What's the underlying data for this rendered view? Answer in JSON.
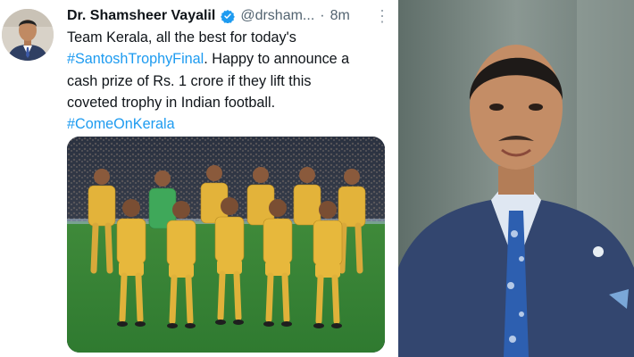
{
  "tweet": {
    "author_name": "Dr. Shamsheer Vayalil",
    "handle": "@drsham...",
    "separator": "·",
    "time": "8m",
    "more_icon": "more-vertical-icon",
    "verified_icon": "verified-badge-icon",
    "text_lines": [
      {
        "text": "Team Kerala, all the best for today's"
      },
      {
        "hashtag": "#SantoshTrophyFinal",
        "text": ". Happy to announce a"
      },
      {
        "text": "cash prize of Rs. 1 crore if they lift this"
      },
      {
        "text": "coveted trophy in Indian football."
      },
      {
        "hashtag": "#ComeOnKerala"
      }
    ],
    "colors": {
      "hashtag": "#1d9bf0",
      "verified": "#1d9bf0",
      "text": "#0f1419",
      "muted": "#536471"
    }
  }
}
